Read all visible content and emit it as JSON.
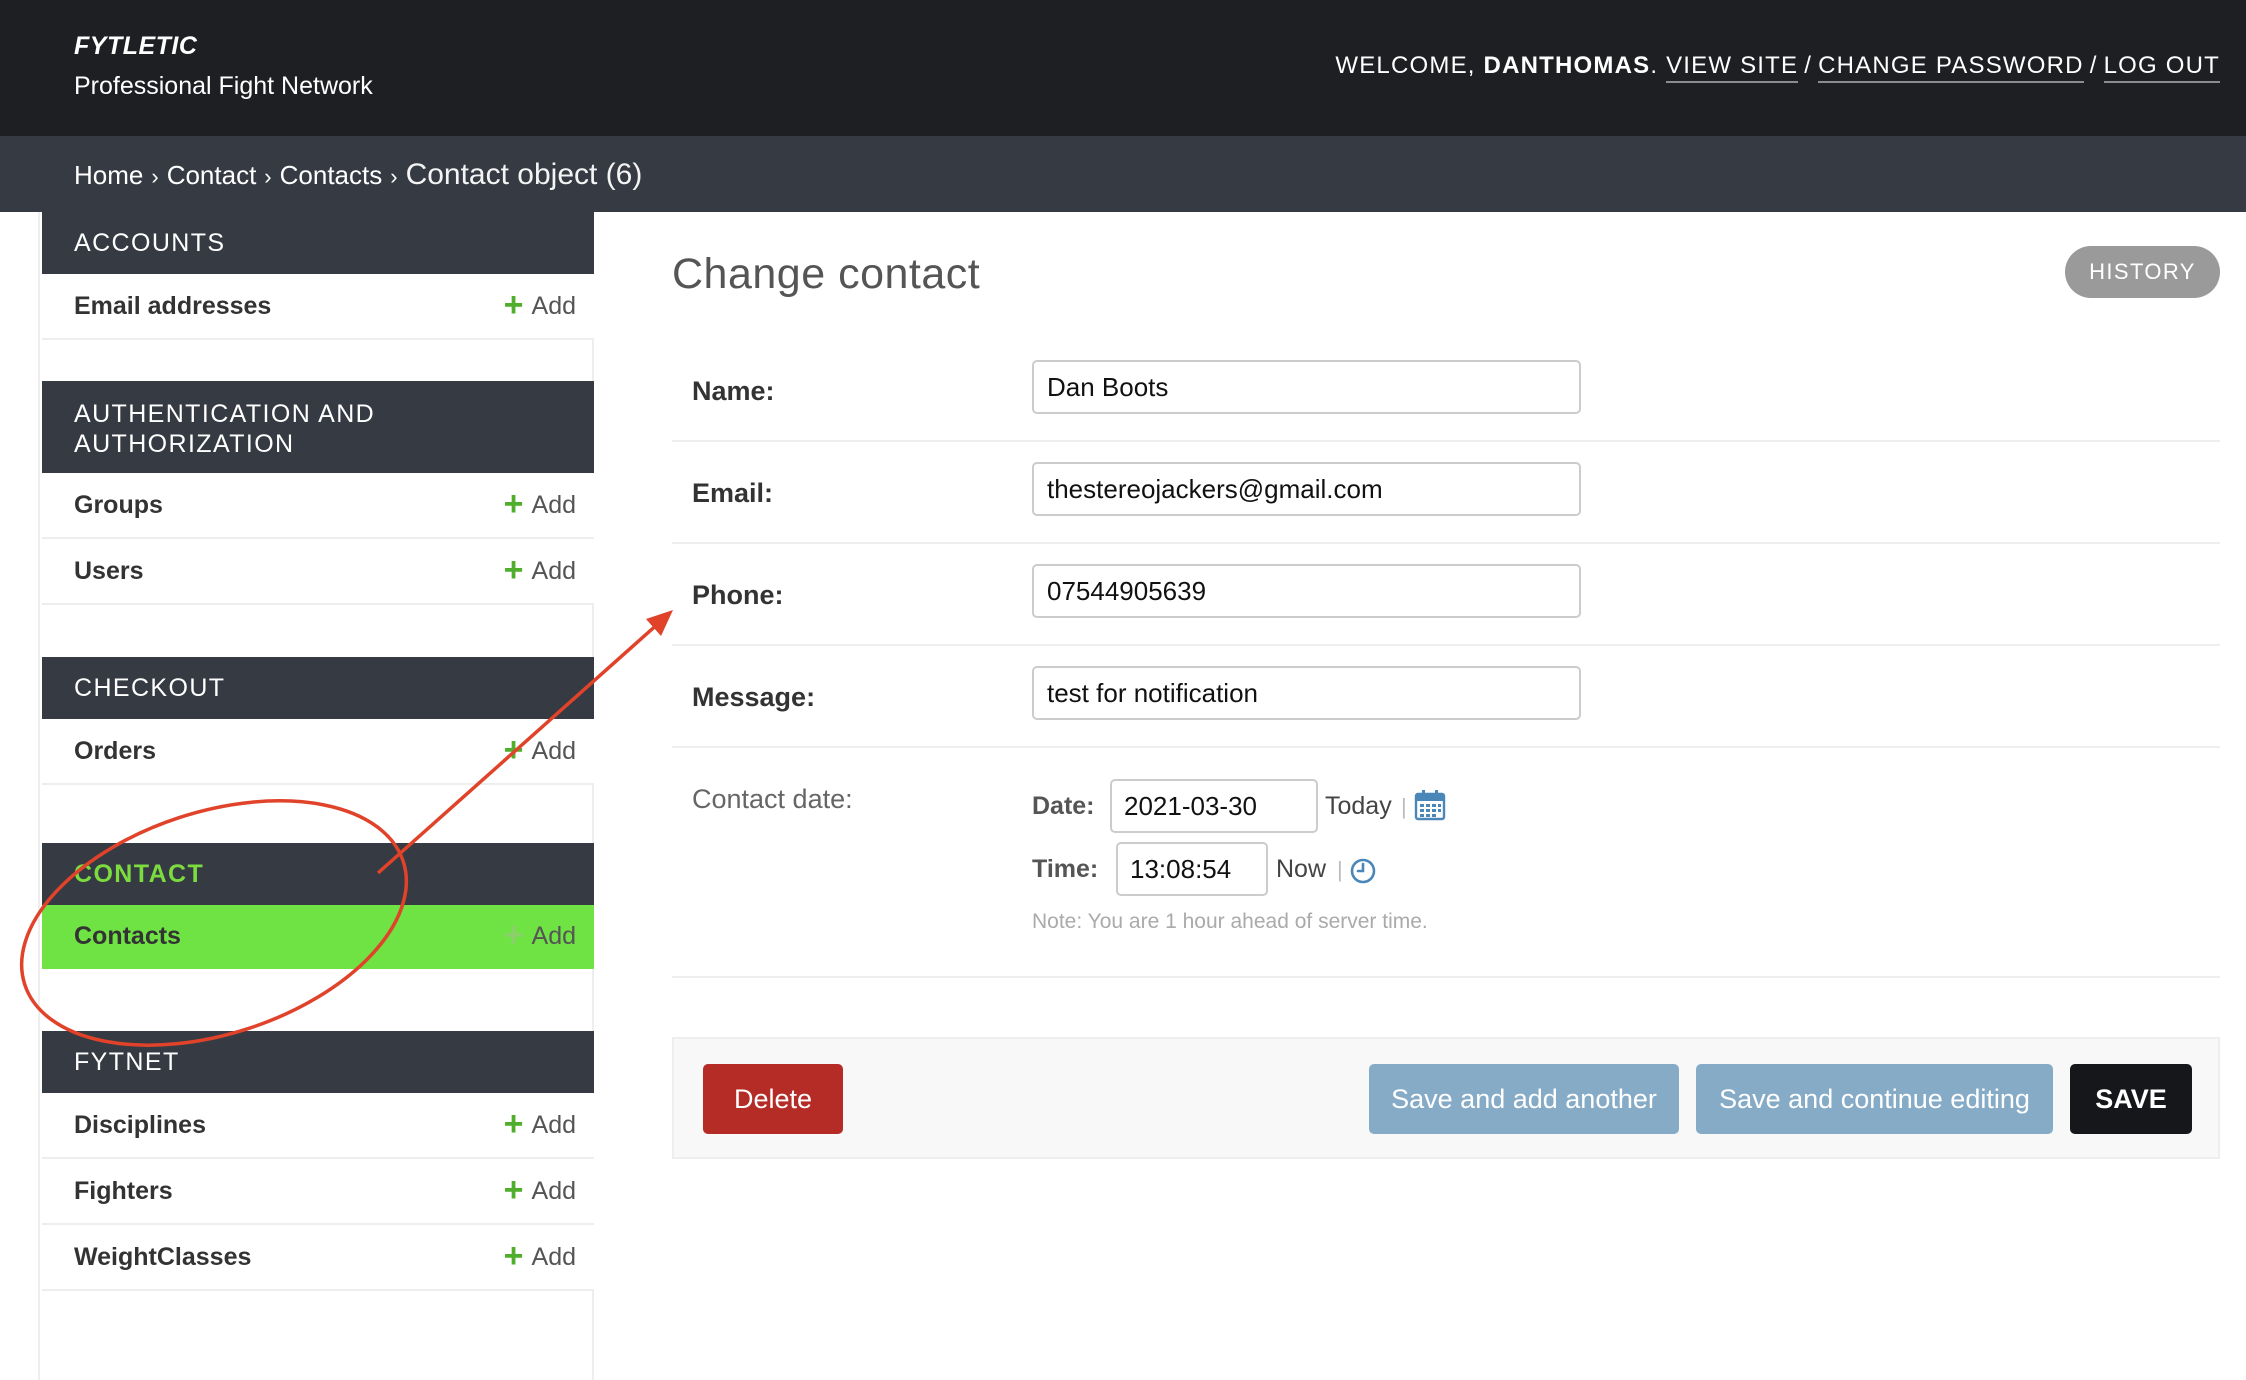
{
  "header": {
    "brand_name": "FYTLETIC",
    "brand_subtitle": "Professional Fight Network",
    "welcome": "WELCOME,",
    "username": "DANTHOMAS",
    "view_site": "VIEW SITE",
    "change_password": "CHANGE PASSWORD",
    "log_out": "LOG OUT",
    "separator": "/"
  },
  "breadcrumbs": {
    "items": [
      "Home",
      "Contact",
      "Contacts"
    ],
    "current": "Contact object (6)",
    "arrow": "›"
  },
  "sidebar": {
    "add_label": "Add",
    "modules": [
      {
        "title": "ACCOUNTS",
        "models": [
          "Email addresses"
        ]
      },
      {
        "title": "AUTHENTICATION AND AUTHORIZATION",
        "models": [
          "Groups",
          "Users"
        ]
      },
      {
        "title": "CHECKOUT",
        "models": [
          "Orders"
        ]
      },
      {
        "title": "CONTACT",
        "models": [
          "Contacts"
        ],
        "active": true
      },
      {
        "title": "FYTNET",
        "models": [
          "Disciplines",
          "Fighters",
          "WeightClasses"
        ]
      }
    ]
  },
  "main": {
    "title": "Change contact",
    "history": "HISTORY",
    "fields": {
      "name": {
        "label": "Name:",
        "value": "Dan Boots"
      },
      "email": {
        "label": "Email:",
        "value": "thestereojackers@gmail.com"
      },
      "phone": {
        "label": "Phone:",
        "value": "07544905639"
      },
      "message": {
        "label": "Message:",
        "value": "test for notification"
      }
    },
    "contact_date": {
      "label": "Contact date:",
      "date_label": "Date:",
      "date_value": "2021-03-30",
      "today": "Today",
      "time_label": "Time:",
      "time_value": "13:08:54",
      "now": "Now",
      "separator": "|",
      "note": "Note: You are 1 hour ahead of server time."
    },
    "buttons": {
      "delete": "Delete",
      "save_add_another": "Save and add another",
      "save_continue": "Save and continue editing",
      "save": "SAVE"
    }
  },
  "colors": {
    "header_bg": "#1e1f22",
    "breadcrumb_bg": "#363a43",
    "active_green": "#6fe244",
    "delete_red": "#b52c26",
    "secondary_blue": "#86abc7",
    "annotation_red": "#e0432a"
  }
}
